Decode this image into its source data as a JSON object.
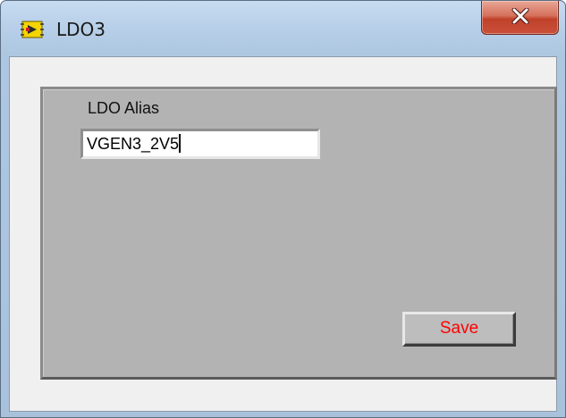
{
  "window": {
    "title": "LDO3",
    "app_icon": "labview-vi-icon",
    "close_icon": "close-icon"
  },
  "panel": {
    "alias_label": "LDO Alias",
    "alias_value": "VGEN3_2V5",
    "save_label": "Save"
  },
  "colors": {
    "panel_bg": "#b3b3b3",
    "save_text": "#ff0000",
    "close_button": "#c9503a"
  }
}
